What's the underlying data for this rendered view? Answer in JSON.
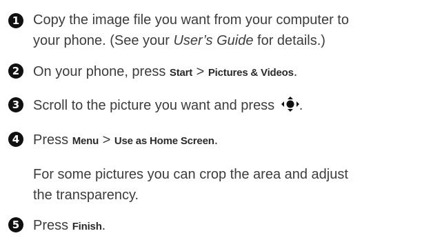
{
  "steps": [
    {
      "number": "1",
      "line1": "Copy the image file you want from your computer to",
      "line2_pre": "your phone. (See your ",
      "line2_italic": "User’s Guide",
      "line2_post": " for details.)"
    },
    {
      "number": "2",
      "pre": "On your phone, press ",
      "key1": "Start",
      "sep": " > ",
      "key2": "Pictures & Videos",
      "post": "."
    },
    {
      "number": "3",
      "pre": "Scroll to the picture you want and press ",
      "icon": "navigation-key-center-icon",
      "post": "."
    },
    {
      "number": "4",
      "pre": "Press ",
      "key1": "Menu",
      "sep": " > ",
      "key2": "Use as Home Screen",
      "post": "."
    },
    {
      "note_line1": "For some pictures you can crop the area and adjust",
      "note_line2": "the transparency."
    },
    {
      "number": "5",
      "pre": "Press ",
      "key1": "Finish",
      "post": "."
    }
  ]
}
